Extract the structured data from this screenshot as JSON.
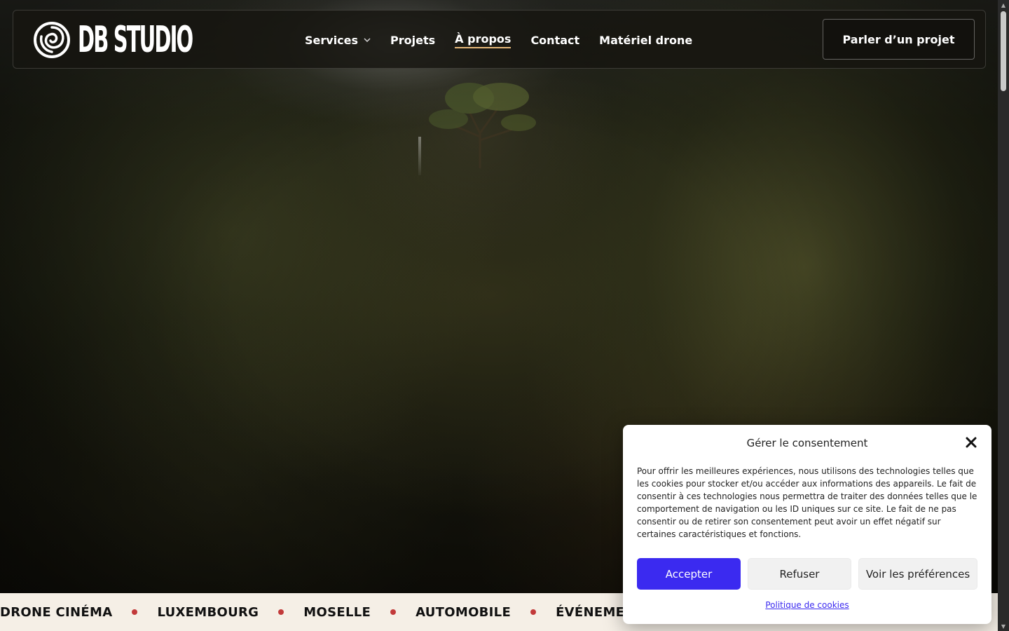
{
  "brand": {
    "name": "DB STUDIO"
  },
  "nav": {
    "items": [
      {
        "label": "Services",
        "has_dropdown": true
      },
      {
        "label": "Projets"
      },
      {
        "label": "À propos",
        "active": true
      },
      {
        "label": "Contact"
      },
      {
        "label": "Matériel drone"
      }
    ],
    "cta_label": "Parler d’un projet"
  },
  "band": {
    "items": [
      "DRONE CINÉMA",
      "LUXEMBOURG",
      "MOSELLE",
      "AUTOMOBILE",
      "ÉVÉNEMENTIEL"
    ],
    "dot_color": "#c23a3a"
  },
  "consent": {
    "title": "Gérer le consentement",
    "text": "Pour offrir les meilleures expériences, nous utilisons des technologies telles que les cookies pour stocker et/ou accéder aux informations des appareils. Le fait de consentir à ces technologies nous permettra de traiter des données telles que le comportement de navigation ou les ID uniques sur ce site. Le fait de ne pas consentir ou de retirer son consentement peut avoir un effet négatif sur certaines caractéristiques et fonctions.",
    "accept_label": "Accepter",
    "refuse_label": "Refuser",
    "prefs_label": "Voir les préférences",
    "policy_link": "Politique de cookies",
    "accent_color": "#3b2af0"
  },
  "icons": {
    "logo": "spiral-logo-icon",
    "dropdown": "chevron-down-icon",
    "close": "close-icon"
  }
}
